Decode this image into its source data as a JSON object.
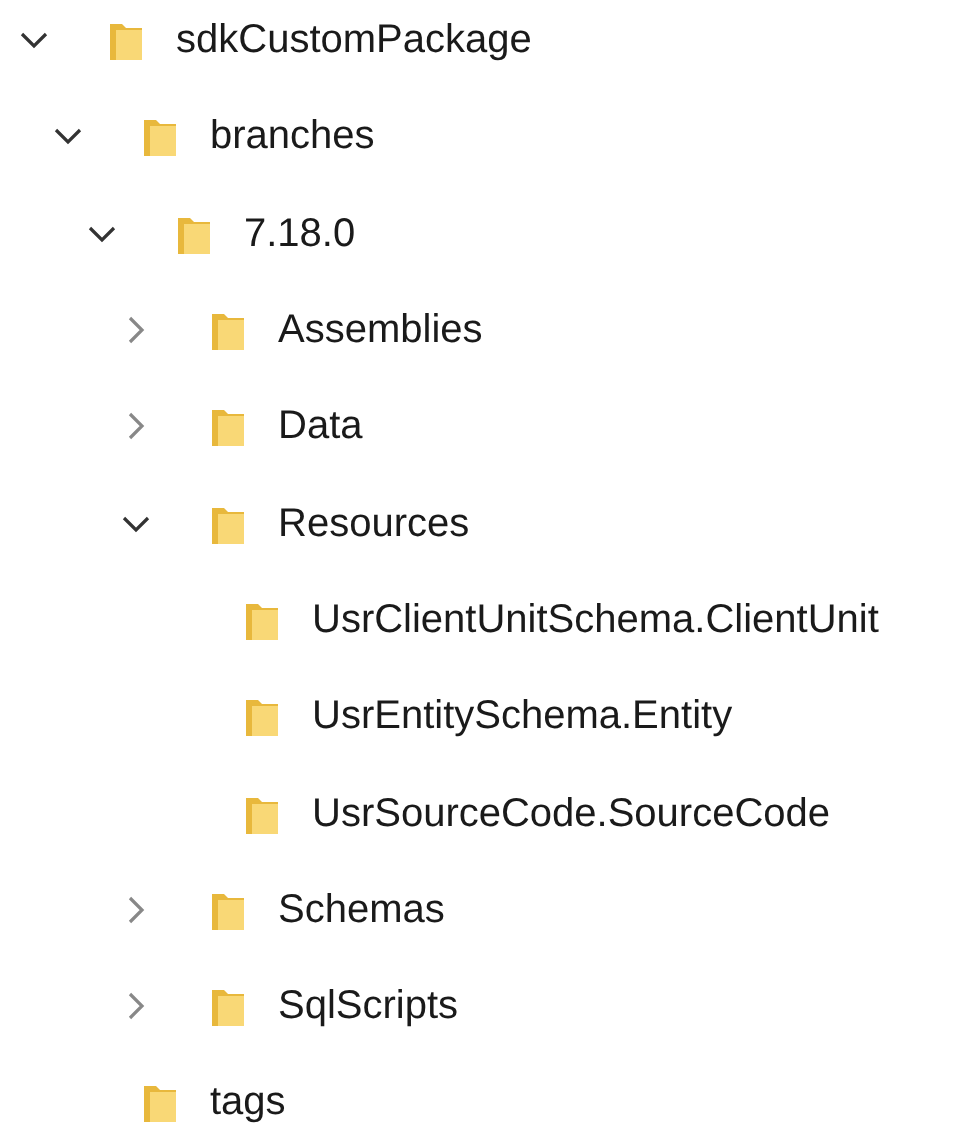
{
  "tree": [
    {
      "label": "sdkCustomPackage",
      "expanded": true,
      "children": [
        {
          "label": "branches",
          "expanded": true,
          "children": [
            {
              "label": "7.18.0",
              "expanded": true,
              "children": [
                {
                  "label": "Assemblies",
                  "expanded": false
                },
                {
                  "label": "Data",
                  "expanded": false
                },
                {
                  "label": "Resources",
                  "expanded": true,
                  "children": [
                    {
                      "label": "UsrClientUnitSchema.ClientUnit"
                    },
                    {
                      "label": "UsrEntitySchema.Entity"
                    },
                    {
                      "label": "UsrSourceCode.SourceCode"
                    }
                  ]
                },
                {
                  "label": "Schemas",
                  "expanded": false
                },
                {
                  "label": "SqlScripts",
                  "expanded": false
                }
              ]
            }
          ]
        },
        {
          "label": "tags"
        }
      ]
    }
  ]
}
